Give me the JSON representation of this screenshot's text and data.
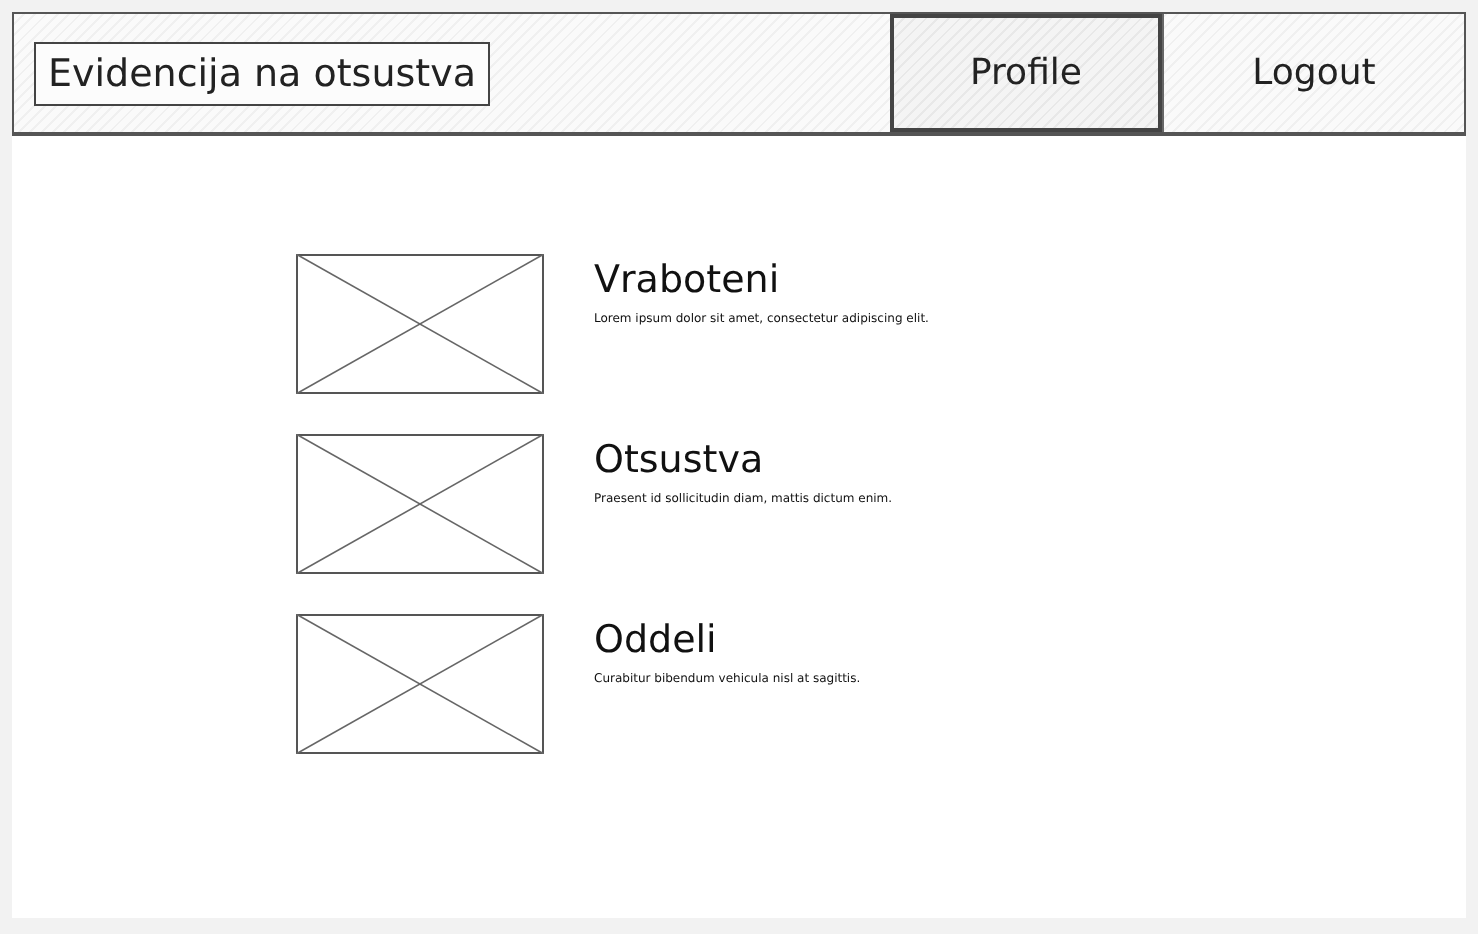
{
  "header": {
    "title": "Evidencija na otsustva",
    "nav": [
      {
        "label": "Profile",
        "selected": true
      },
      {
        "label": "Logout",
        "selected": false
      }
    ]
  },
  "items": [
    {
      "title": "Vraboteni",
      "description": "Lorem ipsum dolor sit amet, consectetur adipiscing elit."
    },
    {
      "title": "Otsustva",
      "description": "Praesent id sollicitudin diam, mattis dictum enim."
    },
    {
      "title": "Oddeli",
      "description": "Curabitur bibendum vehicula nisl at sagittis."
    }
  ]
}
